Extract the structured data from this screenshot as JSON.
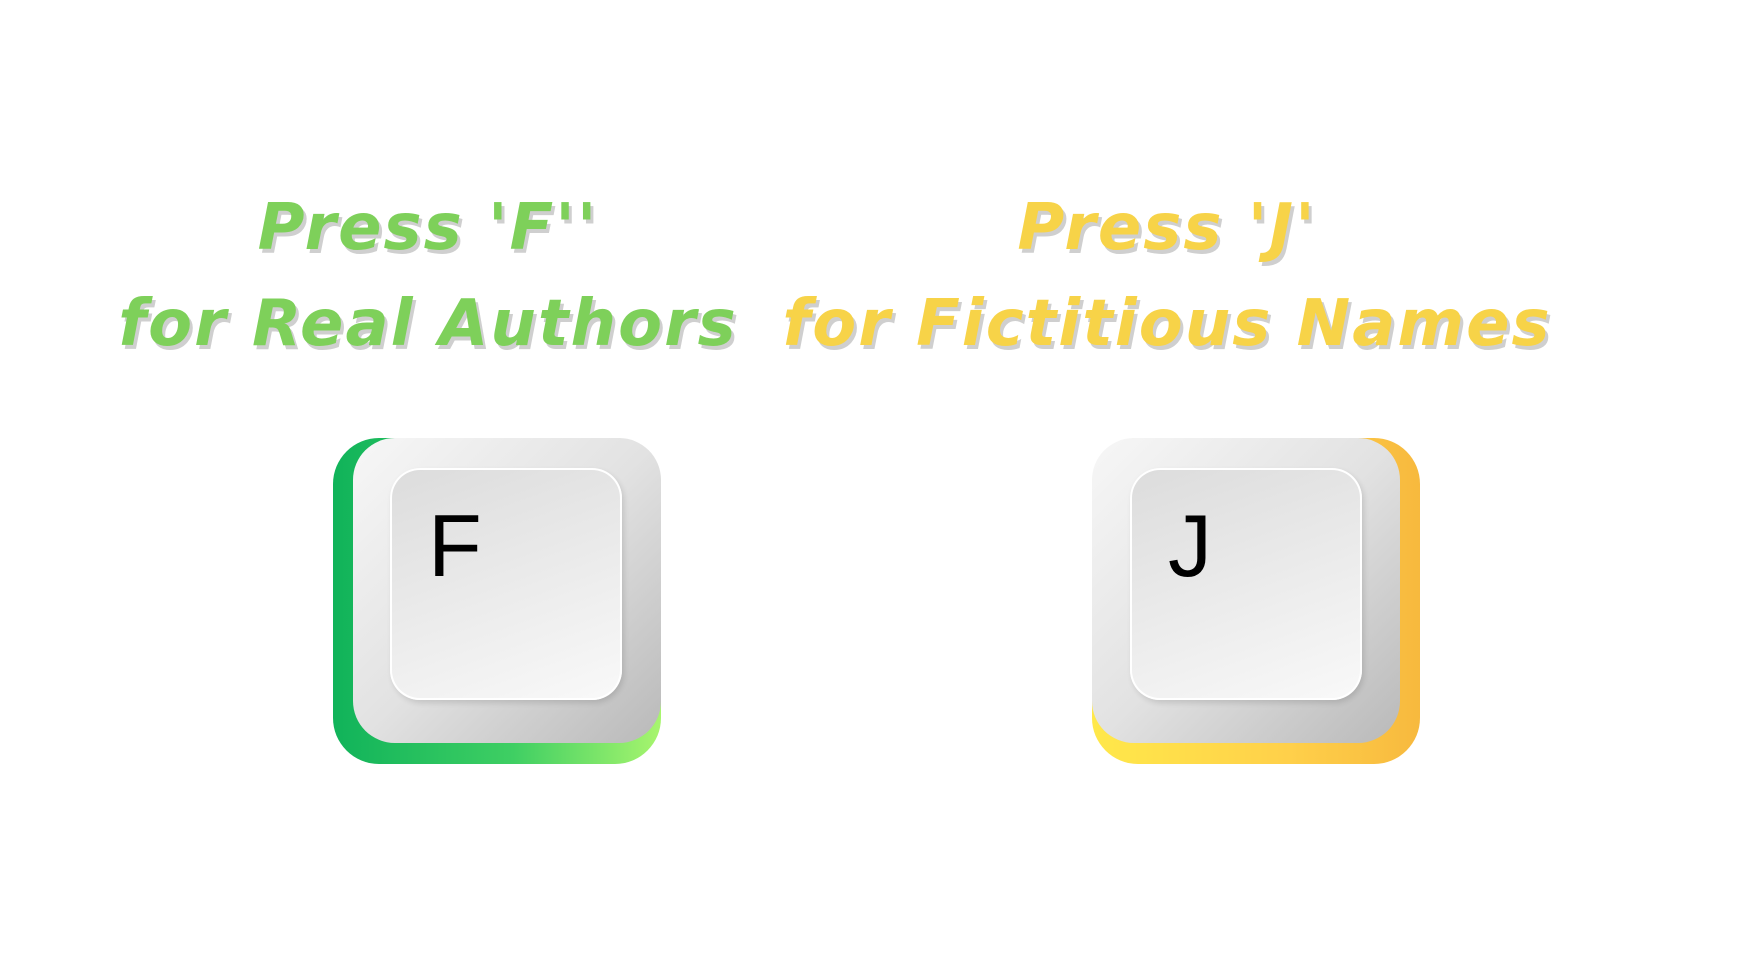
{
  "left": {
    "heading_line1": "Press 'F''",
    "heading_line2": "for Real Authors",
    "key_label": "F",
    "color": "#7ed05a",
    "key_edge_colors": [
      "#10b35a",
      "#a8f56e"
    ]
  },
  "right": {
    "heading_line1": "Press 'J'",
    "heading_line2": "for Fictitious Names",
    "key_label": "J",
    "color": "#f7d348",
    "key_edge_colors": [
      "#ffe84a",
      "#f7b93e"
    ]
  }
}
